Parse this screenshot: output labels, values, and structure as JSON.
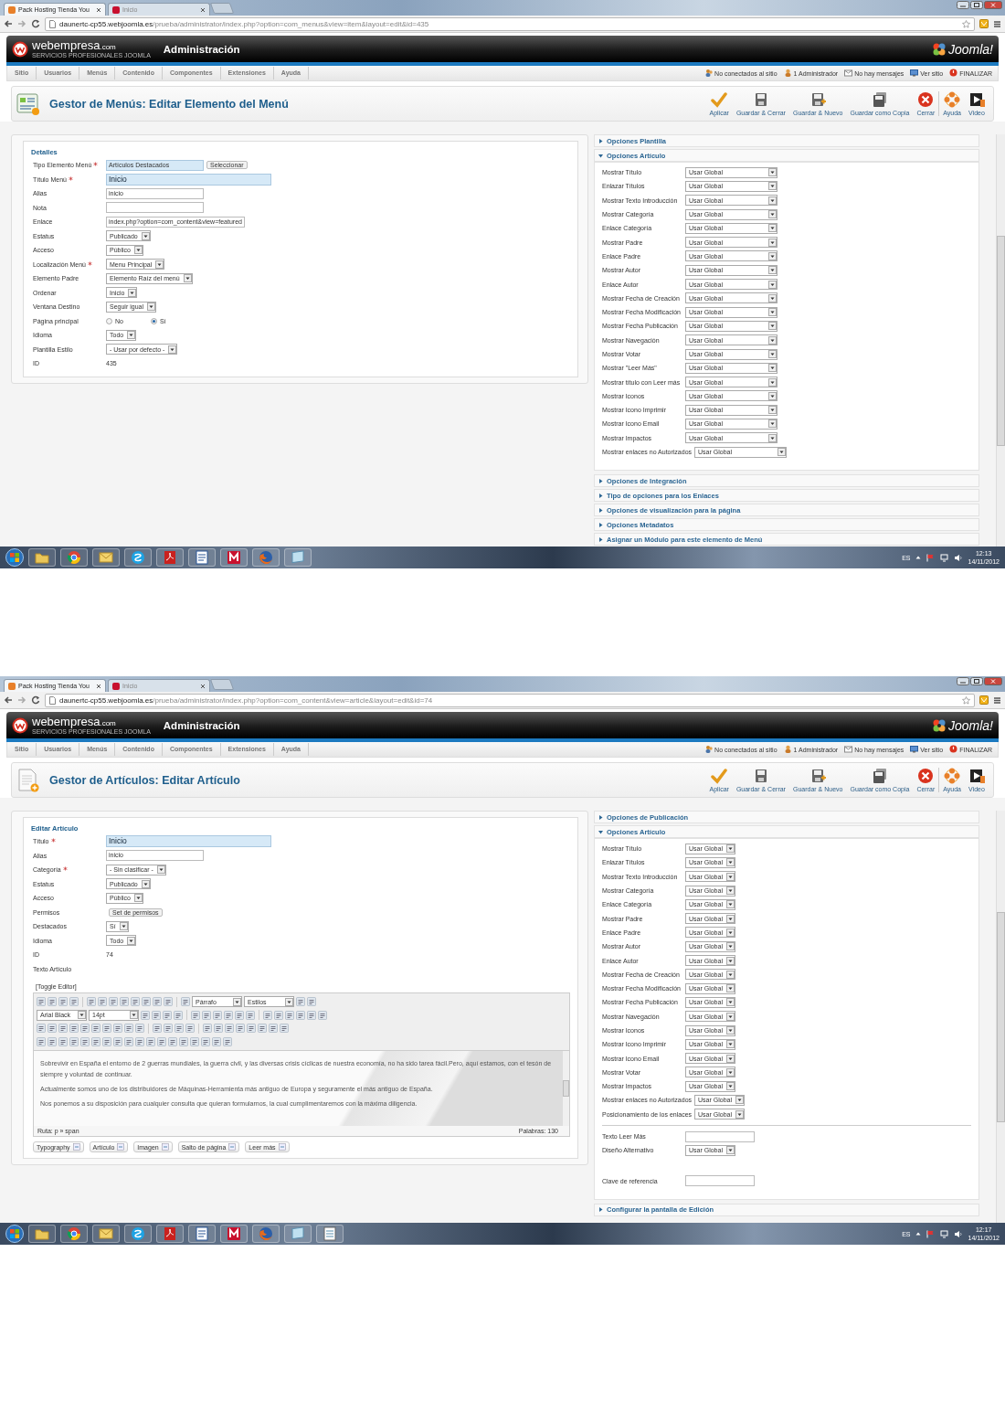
{
  "shots": [
    {
      "kind": "menu-item",
      "tabs": [
        {
          "label": "Pack Hosting Tienda You",
          "selected": true
        },
        {
          "label": "Inicio",
          "selected": false
        }
      ],
      "url": {
        "host": "daunertc-cp55.webjoomla.es",
        "path": "/prueba/administrator/index.php?option=com_menus&view=item&layout=edit&id=435"
      },
      "brand": {
        "name": "webempresa",
        "suffix": ".com",
        "tagline": "SERVICIOS PROFESIONALES JOOMLA"
      },
      "header_title": "Administración",
      "logo_text": "Joomla!",
      "menu": [
        "Sitio",
        "Usuarios",
        "Menús",
        "Contenido",
        "Componentes",
        "Extensiones",
        "Ayuda"
      ],
      "status": [
        {
          "kind": "online",
          "label": "No conectados al sitio"
        },
        {
          "kind": "admin",
          "label": "1 Administrador"
        },
        {
          "kind": "messages",
          "label": "No hay mensajes"
        },
        {
          "kind": "site",
          "label": "Ver sitio"
        },
        {
          "kind": "logout",
          "label": "FINALIZAR"
        }
      ],
      "page_title": "Gestor de Menús: Editar Elemento del Menú",
      "toolbar": [
        {
          "kind": "apply",
          "label": "Aplicar"
        },
        {
          "kind": "save",
          "label": "Guardar & Cerrar"
        },
        {
          "kind": "save-new",
          "label": "Guardar & Nuevo"
        },
        {
          "kind": "save-copy",
          "label": "Guardar como Copia"
        },
        {
          "kind": "close",
          "label": "Cerrar"
        },
        {
          "kind": "help",
          "label": "Ayuda"
        },
        {
          "kind": "video",
          "label": "Video"
        }
      ],
      "form": {
        "legend": "Detalles",
        "fields": [
          {
            "kind": "readonly",
            "label": "Tipo Elemento Menú",
            "required": true,
            "value": "Artículos Destacados",
            "button": "Seleccionar"
          },
          {
            "kind": "title",
            "label": "Título Menú",
            "required": true,
            "value": "Inicio"
          },
          {
            "kind": "text",
            "label": "Alias",
            "required": false,
            "value": "inicio"
          },
          {
            "kind": "text",
            "label": "Nota",
            "required": false
          },
          {
            "kind": "text",
            "label": "Enlace",
            "required": false,
            "value": "index.php?option=com_content&view=featured"
          },
          {
            "kind": "select",
            "label": "Estatus",
            "required": false,
            "value": "Publicado"
          },
          {
            "kind": "select",
            "label": "Acceso",
            "required": false,
            "value": "Público"
          },
          {
            "kind": "select",
            "label": "Localización Menú",
            "required": true,
            "value": "Menu Principal"
          },
          {
            "kind": "select",
            "label": "Elemento Padre",
            "required": false,
            "value": "Elemento Raíz del menú"
          },
          {
            "kind": "select",
            "label": "Ordenar",
            "required": false,
            "value": "Inicio"
          },
          {
            "kind": "select",
            "label": "Ventana Destino",
            "required": false,
            "value": "Seguir igual"
          },
          {
            "kind": "radio",
            "label": "Página principal",
            "required": false,
            "options": [
              {
                "label": "No",
                "selected": false
              },
              {
                "label": "Sí",
                "selected": true
              }
            ]
          },
          {
            "kind": "select",
            "label": "Idioma",
            "required": false,
            "value": "Todo"
          },
          {
            "kind": "select",
            "label": "Plantilla Estilo",
            "required": false,
            "value": "- Usar por defecto -"
          },
          {
            "kind": "static",
            "label": "ID",
            "required": false,
            "value": "435"
          }
        ]
      },
      "panels": [
        {
          "title": "Opciones Plantilla",
          "expanded": false
        },
        {
          "title": "Opciones Artículo",
          "expanded": true,
          "rows": [
            {
              "kind": "select",
              "label": "Mostrar Título",
              "value": "Usar Global"
            },
            {
              "kind": "select",
              "label": "Enlazar Títulos",
              "value": "Usar Global"
            },
            {
              "kind": "select",
              "label": "Mostrar Texto Introducción",
              "value": "Usar Global"
            },
            {
              "kind": "select",
              "label": "Mostrar Categoría",
              "value": "Usar Global"
            },
            {
              "kind": "select",
              "label": "Enlace Categoría",
              "value": "Usar Global"
            },
            {
              "kind": "select",
              "label": "Mostrar Padre",
              "value": "Usar Global"
            },
            {
              "kind": "select",
              "label": "Enlace Padre",
              "value": "Usar Global"
            },
            {
              "kind": "select",
              "label": "Mostrar Autor",
              "value": "Usar Global"
            },
            {
              "kind": "select",
              "label": "Enlace Autor",
              "value": "Usar Global"
            },
            {
              "kind": "select",
              "label": "Mostrar Fecha de Creación",
              "value": "Usar Global"
            },
            {
              "kind": "select",
              "label": "Mostrar Fecha Modificación",
              "value": "Usar Global"
            },
            {
              "kind": "select",
              "label": "Mostrar Fecha Publicación",
              "value": "Usar Global"
            },
            {
              "kind": "select",
              "label": "Mostrar Navegación",
              "value": "Usar Global"
            },
            {
              "kind": "select",
              "label": "Mostrar Votar",
              "value": "Usar Global"
            },
            {
              "kind": "select",
              "label": "Mostrar \"Leer Más\"",
              "value": "Usar Global"
            },
            {
              "kind": "select",
              "label": "Mostrar título con Leer más",
              "value": "Usar Global"
            },
            {
              "kind": "select",
              "label": "Mostrar Iconos",
              "value": "Usar Global"
            },
            {
              "kind": "select",
              "label": "Mostrar Icono Imprimir",
              "value": "Usar Global"
            },
            {
              "kind": "select",
              "label": "Mostrar Icono Email",
              "value": "Usar Global"
            },
            {
              "kind": "select",
              "label": "Mostrar Impactos",
              "value": "Usar Global"
            },
            {
              "kind": "select",
              "label": "Mostrar enlaces no Autorizados",
              "value": "Usar Global"
            }
          ]
        },
        {
          "title": "Opciones de Integración",
          "expanded": false
        },
        {
          "title": "Tipo de opciones para los Enlaces",
          "expanded": false
        },
        {
          "title": "Opciones de visualización para la página",
          "expanded": false
        },
        {
          "title": "Opciones Metadatos",
          "expanded": false
        },
        {
          "title": "Asignar un Módulo para este elemento de Menú",
          "expanded": false
        }
      ],
      "taskbar": {
        "apps": [
          {
            "kind": "folder"
          },
          {
            "kind": "browser"
          },
          {
            "kind": "mail"
          },
          {
            "kind": "chat"
          },
          {
            "kind": "pdf"
          },
          {
            "kind": "word"
          },
          {
            "kind": "antivirus"
          },
          {
            "kind": "firefox"
          },
          {
            "kind": "window"
          }
        ],
        "lang": "ES",
        "time": "12:13",
        "date": "14/11/2012"
      }
    },
    {
      "kind": "article",
      "tabs": [
        {
          "label": "Pack Hosting Tienda You",
          "selected": true
        },
        {
          "label": "Inicio",
          "selected": false
        }
      ],
      "url": {
        "host": "daunertc-cp55.webjoomla.es",
        "path": "/prueba/administrator/index.php?option=com_content&view=article&layout=edit&id=74"
      },
      "brand": {
        "name": "webempresa",
        "suffix": ".com",
        "tagline": "SERVICIOS PROFESIONALES JOOMLA"
      },
      "header_title": "Administración",
      "logo_text": "Joomla!",
      "menu": [
        "Sitio",
        "Usuarios",
        "Menús",
        "Contenido",
        "Componentes",
        "Extensiones",
        "Ayuda"
      ],
      "status": [
        {
          "kind": "online",
          "label": "No conectados al sitio"
        },
        {
          "kind": "admin",
          "label": "1 Administrador"
        },
        {
          "kind": "messages",
          "label": "No hay mensajes"
        },
        {
          "kind": "site",
          "label": "Ver sitio"
        },
        {
          "kind": "logout",
          "label": "FINALIZAR"
        }
      ],
      "page_title": "Gestor de Artículos: Editar Artículo",
      "toolbar": [
        {
          "kind": "apply",
          "label": "Aplicar"
        },
        {
          "kind": "save",
          "label": "Guardar & Cerrar"
        },
        {
          "kind": "save-new",
          "label": "Guardar & Nuevo"
        },
        {
          "kind": "save-copy",
          "label": "Guardar como Copia"
        },
        {
          "kind": "close",
          "label": "Cerrar"
        },
        {
          "kind": "help",
          "label": "Ayuda"
        },
        {
          "kind": "video",
          "label": "Video"
        }
      ],
      "form": {
        "legend": "Editar Artículo",
        "fields": [
          {
            "kind": "title",
            "label": "Título",
            "required": true,
            "value": "Inicio"
          },
          {
            "kind": "text",
            "label": "Alias",
            "required": false,
            "value": "inicio"
          },
          {
            "kind": "select",
            "label": "Categoría",
            "required": true,
            "value": "- Sin clasificar -"
          },
          {
            "kind": "select",
            "label": "Estatus",
            "required": false,
            "value": "Publicado"
          },
          {
            "kind": "select",
            "label": "Acceso",
            "required": false,
            "value": "Público"
          },
          {
            "kind": "button",
            "label": "Permisos",
            "required": false,
            "value": "Set de permisos"
          },
          {
            "kind": "select",
            "label": "Destacados",
            "required": false,
            "value": "Sí"
          },
          {
            "kind": "select",
            "label": "Idioma",
            "required": false,
            "value": "Todo"
          },
          {
            "kind": "static",
            "label": "ID",
            "required": false,
            "value": "74"
          },
          {
            "kind": "label",
            "label": "Texto Artículo",
            "required": false
          }
        ],
        "editor": {
          "toggle": "[Toggle Editor]",
          "selects": [
            "Párrafo",
            "Estilos",
            "Arial Black",
            "14pt"
          ],
          "paragraphs": [
            "Sobrevivir en España el entorno de 2 guerras mundiales, la guerra civil, y las diversas crisis cíclicas de nuestra economía, no ha sido tarea fácil.Pero, aquí estamos, con el tesón de siempre y voluntad de continuar.",
            "Actualmente somos uno de los distribuidores de Máquinas-Herramienta más antiguo de Europa y seguramente el más antiguo de España.",
            "Nos ponemos a su disposición para cualquier consulta que quieran formularnos, la cual cumplimentaremos con la máxima diligencia."
          ],
          "path": "Ruta: p » span",
          "words": "Palabras: 130",
          "buttons": [
            "Typography",
            "Artículo",
            "Imagen",
            "Salto de página",
            "Leer más"
          ]
        }
      },
      "panels": [
        {
          "title": "Opciones de Publicación",
          "expanded": false
        },
        {
          "title": "Opciones Artículo",
          "expanded": true,
          "rows": [
            {
              "kind": "select",
              "label": "Mostrar Título",
              "value": "Usar Global"
            },
            {
              "kind": "select",
              "label": "Enlazar Títulos",
              "value": "Usar Global"
            },
            {
              "kind": "select",
              "label": "Mostrar Texto Introducción",
              "value": "Usar Global"
            },
            {
              "kind": "select",
              "label": "Mostrar Categoría",
              "value": "Usar Global"
            },
            {
              "kind": "select",
              "label": "Enlace Categoría",
              "value": "Usar Global"
            },
            {
              "kind": "select",
              "label": "Mostrar Padre",
              "value": "Usar Global"
            },
            {
              "kind": "select",
              "label": "Enlace Padre",
              "value": "Usar Global"
            },
            {
              "kind": "select",
              "label": "Mostrar Autor",
              "value": "Usar Global"
            },
            {
              "kind": "select",
              "label": "Enlace Autor",
              "value": "Usar Global"
            },
            {
              "kind": "select",
              "label": "Mostrar Fecha de Creación",
              "value": "Usar Global"
            },
            {
              "kind": "select",
              "label": "Mostrar Fecha Modificación",
              "value": "Usar Global"
            },
            {
              "kind": "select",
              "label": "Mostrar Fecha Publicación",
              "value": "Usar Global"
            },
            {
              "kind": "select",
              "label": "Mostrar Navegación",
              "value": "Usar Global"
            },
            {
              "kind": "select",
              "label": "Mostrar Iconos",
              "value": "Usar Global"
            },
            {
              "kind": "select",
              "label": "Mostrar Icono Imprimir",
              "value": "Usar Global"
            },
            {
              "kind": "select",
              "label": "Mostrar Icono Email",
              "value": "Usar Global"
            },
            {
              "kind": "select",
              "label": "Mostrar Votar",
              "value": "Usar Global"
            },
            {
              "kind": "select",
              "label": "Mostrar Impactos",
              "value": "Usar Global"
            },
            {
              "kind": "select",
              "label": "Mostrar enlaces no Autorizados",
              "value": "Usar Global"
            },
            {
              "kind": "select",
              "label": "Posicionamiento de los enlaces",
              "value": "Usar Global"
            }
          ],
          "rows_after_rule": [
            {
              "kind": "text",
              "label": "Texto Leer Más"
            },
            {
              "kind": "select",
              "label": "Diseño Alternativo",
              "value": "Usar Global"
            },
            {
              "kind": "text",
              "label": "Clave de referencia"
            }
          ]
        },
        {
          "title": "Configurar la pantalla de Edición",
          "expanded": false
        }
      ],
      "taskbar": {
        "apps": [
          {
            "kind": "folder"
          },
          {
            "kind": "browser"
          },
          {
            "kind": "mail"
          },
          {
            "kind": "chat"
          },
          {
            "kind": "pdf"
          },
          {
            "kind": "word"
          },
          {
            "kind": "antivirus"
          },
          {
            "kind": "firefox"
          },
          {
            "kind": "window"
          },
          {
            "kind": "notepad"
          }
        ],
        "lang": "ES",
        "time": "12:17",
        "date": "14/11/2012"
      }
    }
  ]
}
